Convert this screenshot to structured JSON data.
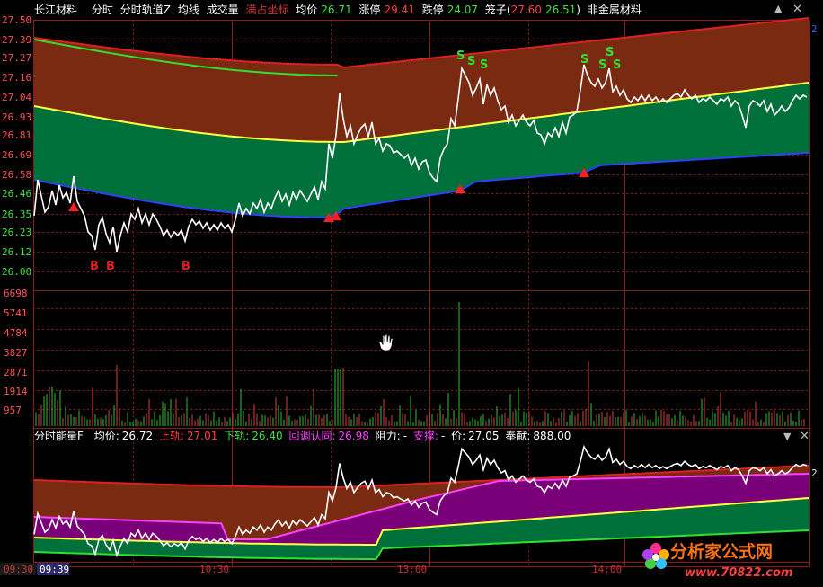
{
  "header": {
    "stock_name": "长江材料",
    "tabs": [
      "分时",
      "分时轨道Z",
      "均线",
      "成交量"
    ],
    "overlay_mode": "满占坐标",
    "avg_label": "均价",
    "avg_value": "26.71",
    "limit_up_label": "涨停",
    "limit_up_value": "29.41",
    "limit_down_label": "跌停",
    "limit_down_value": "24.07",
    "cage_label": "笼子(",
    "cage_high": "27.60",
    "cage_low": "26.51",
    "cage_close": ")",
    "sector": "非金属材料"
  },
  "price_axis": {
    "labels": [
      "27.50",
      "27.39",
      "27.27",
      "27.16",
      "27.04",
      "26.93",
      "26.81",
      "26.69",
      "26.58",
      "26.46",
      "26.35",
      "26.23",
      "26.12",
      "26.00"
    ],
    "right_tick": "2"
  },
  "volume_axis": {
    "labels": [
      "6698",
      "5741",
      "4784",
      "3827",
      "2871",
      "1914",
      "957"
    ]
  },
  "lower_panel": {
    "title": "分时能量F",
    "avg_label": "均价:",
    "avg_value": "26.72",
    "upper_label": "上轨:",
    "upper_value": "27.01",
    "lower_label": "下轨:",
    "lower_value": "26.40",
    "pullback_label": "回调认同:",
    "pullback_value": "26.98",
    "resistance_label": "阻力:",
    "resistance_value": "-",
    "support_label": "支撑:",
    "support_value": "-",
    "price_label": "价:",
    "price_value": "27.05",
    "contribution_label": "奉献:",
    "contribution_value": "888.00",
    "right_tick": "2",
    "collapse_icon": "triangle-down",
    "close_icon": "x"
  },
  "time_axis": {
    "labels": [
      "09:30",
      "10:30",
      "13:00",
      "14:00"
    ],
    "cursor_time": "09:39"
  },
  "signals": {
    "buy_letter": "B",
    "sell_letter": "S"
  },
  "watermark": {
    "text": "分析家公式网",
    "url": "www.70822.com"
  },
  "colors": {
    "up_band": "#7a2a10",
    "down_band": "#00703a",
    "purple_band": "#7a007a",
    "price_line": "#ffffff",
    "yellow_line": "#ffff40",
    "red_line": "#e02020",
    "green_line": "#30e030",
    "blue_line": "#3040ff",
    "grid": "#8b1a1a",
    "volume_up": "#d04040",
    "volume_down": "#30c030"
  }
}
